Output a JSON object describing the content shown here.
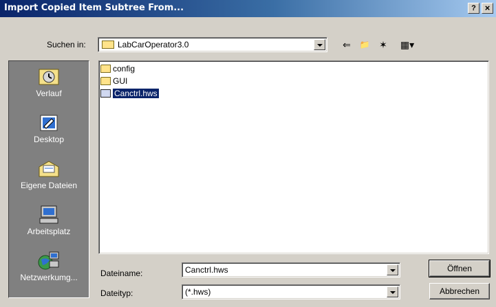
{
  "window": {
    "title": "Import Copied Item Subtree From...",
    "help_label": "?",
    "close_label": "×"
  },
  "lookin": {
    "label": "Suchen in:",
    "value": "LabCarOperator3.0"
  },
  "toolbar": {
    "back_glyph": "⇐",
    "up_glyph": "📁",
    "newfolder_glyph": "✶",
    "views_glyph": "▦▾"
  },
  "places": [
    {
      "label": "Verlauf",
      "icon": "history-icon"
    },
    {
      "label": "Desktop",
      "icon": "desktop-icon"
    },
    {
      "label": "Eigene Dateien",
      "icon": "my-documents-icon"
    },
    {
      "label": "Arbeitsplatz",
      "icon": "my-computer-icon"
    },
    {
      "label": "Netzwerkumg...",
      "icon": "network-icon"
    }
  ],
  "files": [
    {
      "name": "config",
      "type": "folder",
      "selected": false
    },
    {
      "name": "GUI",
      "type": "folder",
      "selected": false
    },
    {
      "name": "Canctrl.hws",
      "type": "file",
      "selected": true
    }
  ],
  "filename": {
    "label": "Dateiname:",
    "value": "Canctrl.hws"
  },
  "filetype": {
    "label": "Dateityp:",
    "value": "(*.hws)"
  },
  "buttons": {
    "open": "Öffnen",
    "cancel": "Abbrechen"
  }
}
